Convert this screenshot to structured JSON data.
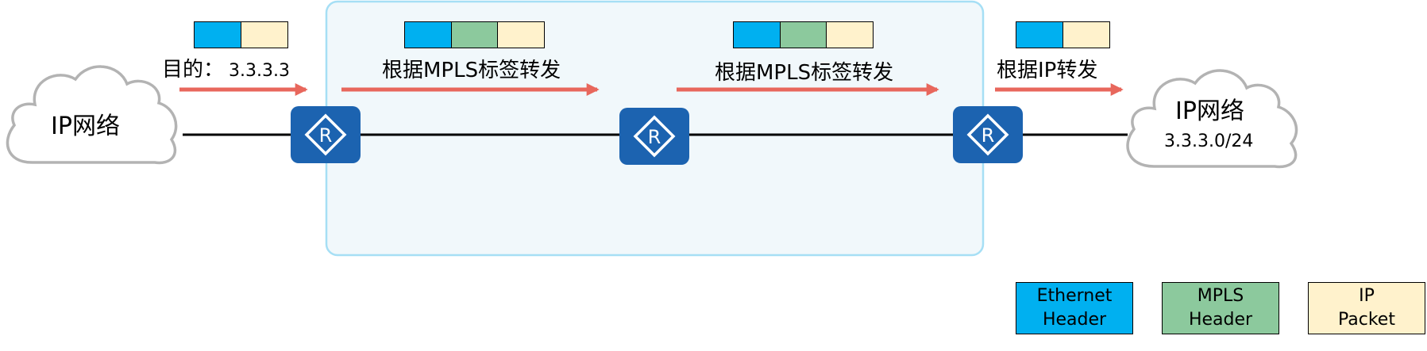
{
  "colors": {
    "ethernet": "#00b0f0",
    "mpls": "#8cc99d",
    "ip": "#fff2cc",
    "arrow": "#e8675c",
    "router": "#1c63b0",
    "mpls_domain_fill": "#f1f8fb",
    "mpls_domain_border": "#a6dff5",
    "cloud_border": "#b3b3b3"
  },
  "left_cloud": {
    "label": "IP网络",
    "icon": "cloud-icon"
  },
  "right_cloud": {
    "label": "IP网络",
    "subnet": "3.3.3.0/24",
    "icon": "cloud-icon"
  },
  "routers": [
    {
      "icon": "router-icon",
      "glyph": "R"
    },
    {
      "icon": "router-icon",
      "glyph": "R"
    },
    {
      "icon": "router-icon",
      "glyph": "R"
    }
  ],
  "hops": [
    {
      "label_prefix": "目的：",
      "label_value": "3.3.3.3",
      "packet": [
        "ethernet",
        "ip"
      ]
    },
    {
      "label": "根据MPLS标签转发",
      "packet": [
        "ethernet",
        "mpls",
        "ip"
      ]
    },
    {
      "label": "根据MPLS标签转发",
      "packet": [
        "ethernet",
        "mpls",
        "ip"
      ]
    },
    {
      "label": "根据IP转发",
      "packet": [
        "ethernet",
        "ip"
      ]
    }
  ],
  "legend": [
    {
      "key": "ethernet",
      "line1": "Ethernet",
      "line2": "Header"
    },
    {
      "key": "mpls",
      "line1": "MPLS",
      "line2": "Header"
    },
    {
      "key": "ip",
      "line1": "IP",
      "line2": "Packet"
    }
  ]
}
